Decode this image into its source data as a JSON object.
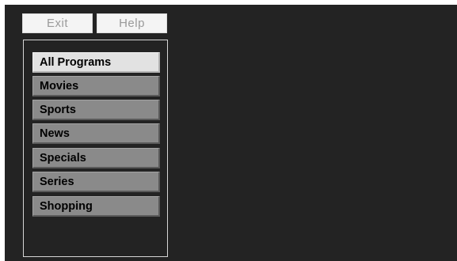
{
  "top_bar": {
    "exit_label": "Exit",
    "help_label": "Help"
  },
  "menu": {
    "selected_index": 0,
    "items": [
      {
        "label": "All Programs"
      },
      {
        "label": "Movies"
      },
      {
        "label": "Sports"
      },
      {
        "label": "News"
      },
      {
        "label": "Specials"
      },
      {
        "label": "Series"
      },
      {
        "label": "Shopping"
      }
    ]
  },
  "colors": {
    "screen_background": "#232323",
    "menu_item": "#8a8a8a",
    "menu_item_selected": "#e2e2e2",
    "top_button": "#f4f4f4",
    "top_button_text": "#9a9a9a"
  }
}
